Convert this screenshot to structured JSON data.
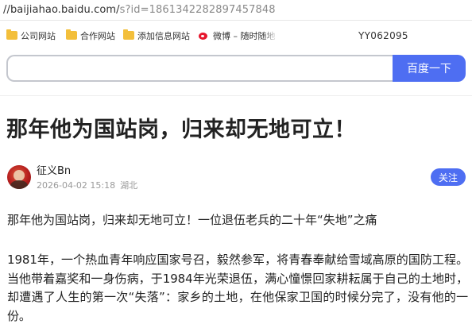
{
  "browser": {
    "url_host": "//baijiahao.baidu.com/",
    "url_path": "s?id=1861342282897457848"
  },
  "bookmarks": [
    {
      "label": "公司网站",
      "icon": "folder-icon"
    },
    {
      "label": "合作网站",
      "icon": "folder-icon"
    },
    {
      "label": "添加信息网站",
      "icon": "folder-icon"
    },
    {
      "label": "微博 – 随时随地",
      "icon": "weibo-icon"
    }
  ],
  "tag": "YY062095",
  "search": {
    "value": "",
    "button_label": "百度一下"
  },
  "article": {
    "title": "那年他为国站岗，归来却无地可立！",
    "author": "征义Bn",
    "date": "2026-04-02 15:18",
    "location": "湖北",
    "follow_label": "关注",
    "paragraphs": [
      "那年他为国站岗，归来却无地可立！一位退伍老兵的二十年“失地”之痛",
      "1981年，一个热血青年响应国家号召，毅然参军，将青春奉献给雪域高原的国防工程。当他带着嘉奖和一身伤病，于1984年光荣退伍，满心憧憬回家耕耘属于自己的土地时，却遭遇了人生的第一次“失落”：家乡的土地，在他保家卫国的时候分完了，没有他的一份。"
    ]
  },
  "colors": {
    "accent": "#4e6ef2",
    "folder": "#f3bf3b",
    "weibo": "#e6162d"
  }
}
